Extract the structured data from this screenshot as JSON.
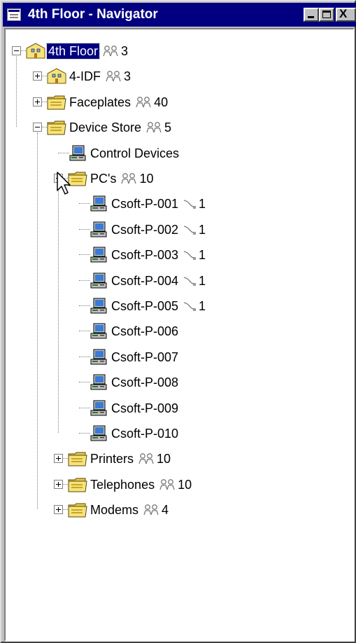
{
  "window": {
    "title": "4th Floor - Navigator",
    "icon": "navigator-app-icon",
    "buttons": [
      "minimize-icon",
      "maximize-icon",
      "close-icon"
    ],
    "close_glyph": "X"
  },
  "tree": {
    "root": {
      "label": "4th Floor",
      "icon": "building-folder-icon",
      "badge_icon": "users-icon",
      "count": "3",
      "expanded": true,
      "selected": true
    },
    "level1": [
      {
        "label": "4-IDF",
        "icon": "building-folder-icon",
        "badge_icon": "users-icon",
        "count": "3",
        "expanded": false
      },
      {
        "label": "Faceplates",
        "icon": "folder-icon",
        "badge_icon": "users-icon",
        "count": "40",
        "expanded": false
      },
      {
        "label": "Device Store",
        "icon": "folder-icon",
        "badge_icon": "users-icon",
        "count": "5",
        "expanded": true
      }
    ],
    "device_store_children": [
      {
        "label": "Control Devices",
        "icon": "computer-icon"
      },
      {
        "label": "PC's",
        "icon": "folder-icon",
        "badge_icon": "users-icon",
        "count": "10",
        "expanded": true
      }
    ],
    "pcs": [
      {
        "label": "Csoft-P-001",
        "badge_icon": "cable-icon",
        "count": "1"
      },
      {
        "label": "Csoft-P-002",
        "badge_icon": "cable-icon",
        "count": "1"
      },
      {
        "label": "Csoft-P-003",
        "badge_icon": "cable-icon",
        "count": "1"
      },
      {
        "label": "Csoft-P-004",
        "badge_icon": "cable-icon",
        "count": "1"
      },
      {
        "label": "Csoft-P-005",
        "badge_icon": "cable-icon",
        "count": "1"
      },
      {
        "label": "Csoft-P-006"
      },
      {
        "label": "Csoft-P-007"
      },
      {
        "label": "Csoft-P-008"
      },
      {
        "label": "Csoft-P-009"
      },
      {
        "label": "Csoft-P-010"
      }
    ],
    "after": [
      {
        "label": "Printers",
        "icon": "folder-icon",
        "badge_icon": "users-icon",
        "count": "10",
        "expanded": false
      },
      {
        "label": "Telephones",
        "icon": "folder-icon",
        "badge_icon": "users-icon",
        "count": "10",
        "expanded": false
      },
      {
        "label": "Modems",
        "icon": "folder-icon",
        "badge_icon": "users-icon",
        "count": "4",
        "expanded": false
      }
    ]
  },
  "colors": {
    "titlebar": "#000080",
    "selection": "#000080",
    "folder": "#f7e37c",
    "monitor": "#3a7bd5"
  }
}
